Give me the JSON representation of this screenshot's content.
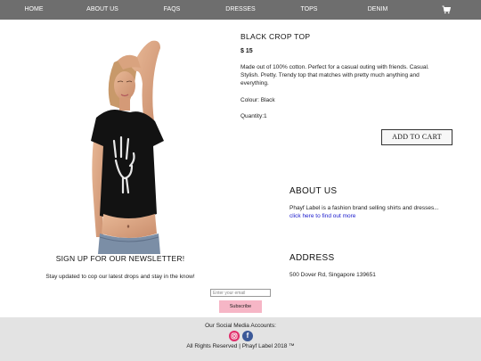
{
  "nav": {
    "items": [
      "HOME",
      "ABOUT US",
      "FAQS",
      "DRESSES",
      "TOPS",
      "DENIM"
    ],
    "cart_icon": "cart-icon",
    "background": "#6e6e6e"
  },
  "product": {
    "name": "BLACK CROP TOP",
    "price": "$ 15",
    "description": "Made out of 100% cotton. Perfect for a casual outing with friends. Casual. Stylish. Pretty. Trendy top that matches with pretty much anything and everything.",
    "colour": "Colour: Black",
    "quantity": "Quantity:1",
    "add_to_cart": "ADD TO CART"
  },
  "about": {
    "heading": "ABOUT US",
    "text": "Phayf Label is a fashion brand selling shirts and dresses...",
    "link": "click here to find out more"
  },
  "newsletter": {
    "heading": "SIGN UP FOR OUR NEWSLETTER!",
    "text": "Stay updated to cop our latest drops and stay in the know!",
    "email_placeholder": "Enter your email",
    "subscribe": "Subscribe",
    "button_color": "#f6b6c6"
  },
  "address": {
    "heading": "ADDRESS",
    "text": "500 Dover Rd, Singapore 139651"
  },
  "footer": {
    "social_text": "Our Social Media Accounts:",
    "icons": [
      "instagram-icon",
      "facebook-icon"
    ],
    "rights": "All Rights Reserved | Phayf Label 2018 ™",
    "background": "#e3e3e3"
  }
}
